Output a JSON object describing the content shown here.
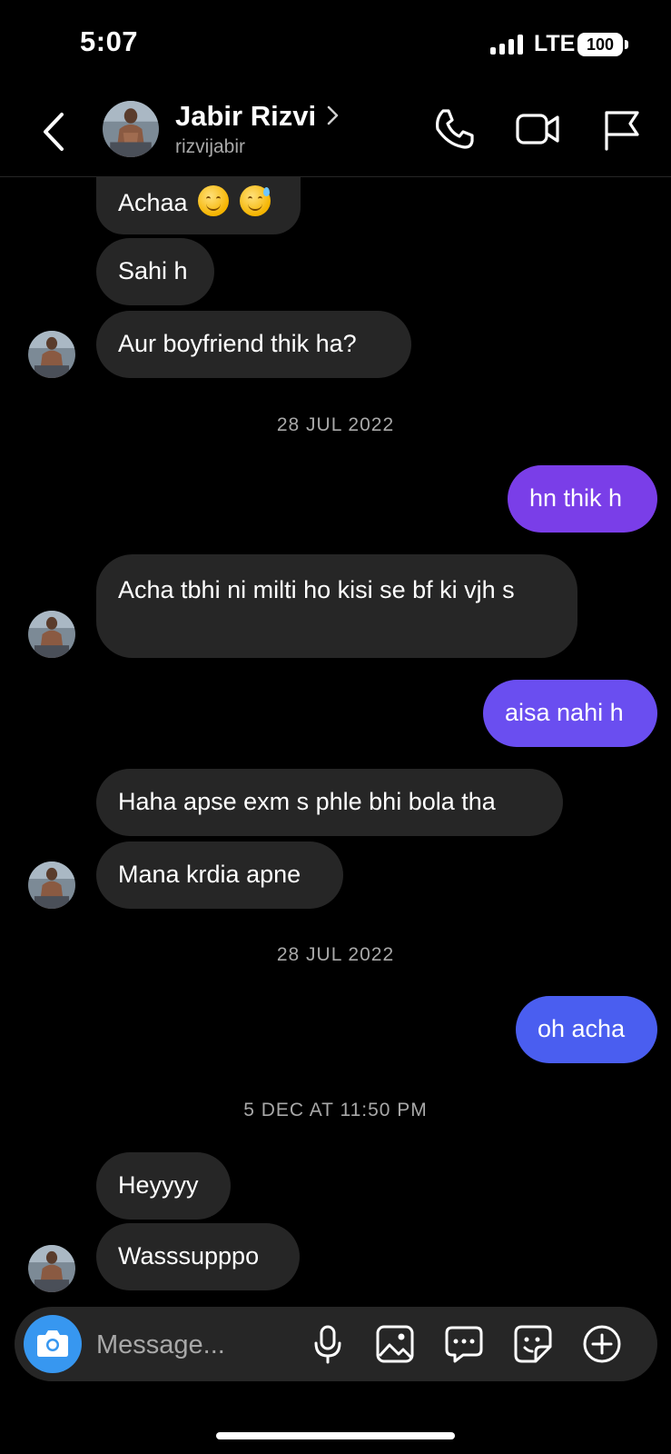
{
  "status_bar": {
    "time": "5:07",
    "network": "LTE",
    "battery": "100"
  },
  "header": {
    "name": "Jabir Rizvi",
    "username": "rizvijabir",
    "back_icon": "chevron-left-icon",
    "call_icon": "phone-icon",
    "video_icon": "video-camera-icon",
    "report_icon": "flag-icon"
  },
  "messages": {
    "m1": "Achaa",
    "m2": "Sahi h",
    "m3": "Aur boyfriend thik ha?",
    "d1": "28 JUL 2022",
    "m4": "hn thik h",
    "m5": "Acha tbhi ni milti ho kisi se bf ki vjh s",
    "m6": "aisa nahi h",
    "m7": "Haha apse exm s phle bhi bola tha",
    "m8": "Mana krdia apne",
    "d2": "28 JUL 2022",
    "m9": "oh acha",
    "d3": "5 DEC AT 11:50 PM",
    "m10": "Heyyyy",
    "m11": "Wasssupppo"
  },
  "composer": {
    "placeholder": "Message...",
    "icons": [
      "camera-icon",
      "microphone-icon",
      "image-icon",
      "chat-bubble-icon",
      "sticker-icon",
      "plus-circle-icon"
    ]
  },
  "colors": {
    "incoming_bubble": "#262626",
    "outgoing_purple": "#7a3ee8",
    "outgoing_violet": "#6a4ef0",
    "outgoing_blue": "#4a5ef0",
    "camera_button": "#3797f0"
  }
}
